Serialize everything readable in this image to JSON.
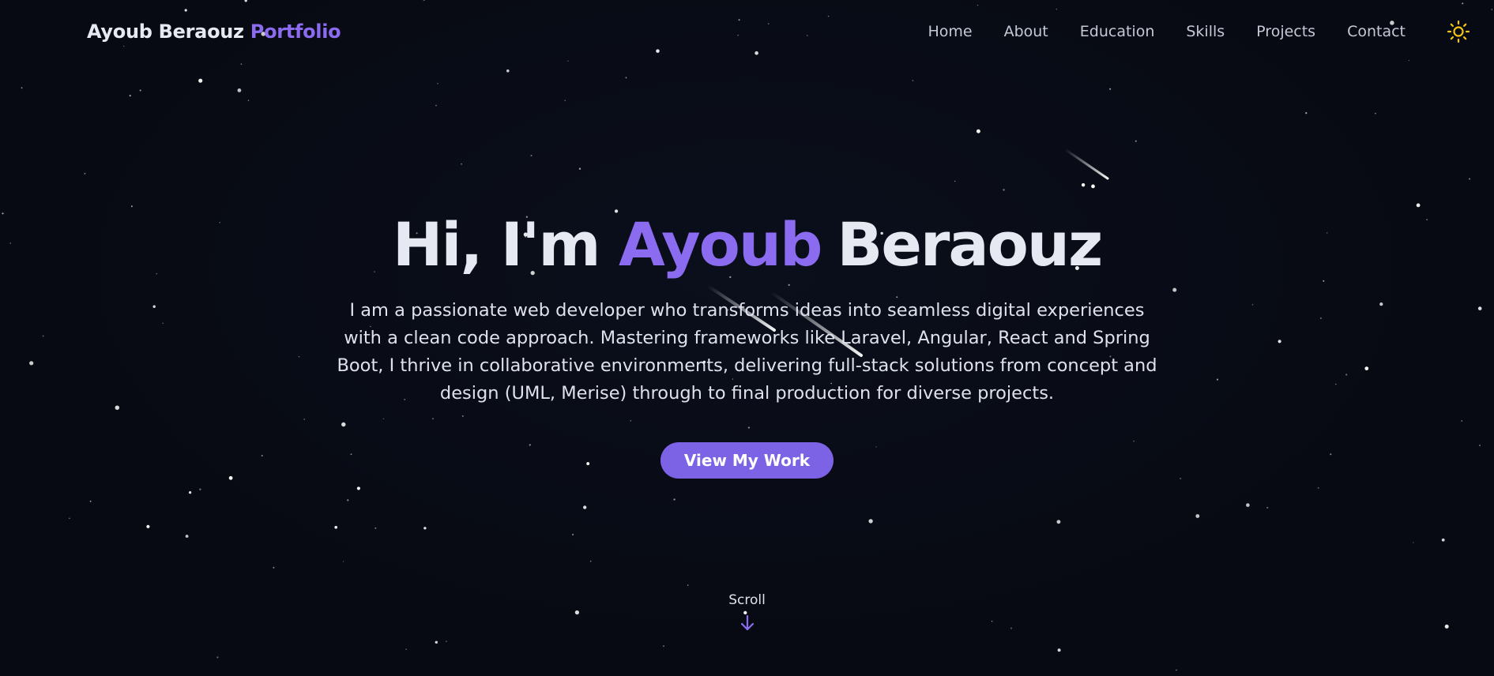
{
  "nav": {
    "brand_name": "Ayoub Beraouz",
    "brand_accent": "Portfolio",
    "links": [
      "Home",
      "About",
      "Education",
      "Skills",
      "Projects",
      "Contact"
    ],
    "theme_icon": "sun-icon"
  },
  "hero": {
    "greeting": "Hi, I'm",
    "first_name": "Ayoub",
    "last_name": "Beraouz",
    "description": "I am a passionate web developer who transforms ideas into seamless digital experiences with a clean code approach. Mastering frameworks like Laravel, Angular, React and Spring Boot, I thrive in collaborative environments, delivering full-stack solutions from concept and design (UML, Merise) through to final production for diverse projects.",
    "cta_label": "View My Work"
  },
  "scroll": {
    "label": "Scroll",
    "icon": "arrow-down-icon"
  },
  "colors": {
    "background": "#070a12",
    "accent": "#8b6cf0",
    "button": "#7c63e6",
    "sun": "#f5c518"
  }
}
